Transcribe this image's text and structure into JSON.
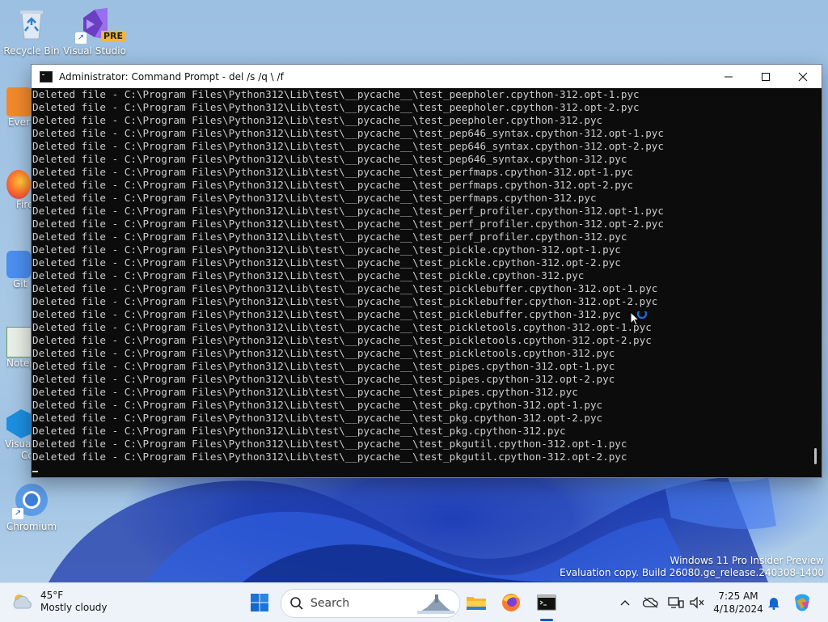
{
  "desktop": {
    "icons": [
      {
        "label": "Recycle Bin"
      },
      {
        "label": "Visual Studio",
        "badge": "PRE"
      },
      {
        "label": "Chromium"
      }
    ],
    "partial_labels": [
      "Every",
      "Fire",
      "Git",
      "Notep",
      "Visual",
      "Co"
    ],
    "watermark": {
      "line1": "Windows 11 Pro Insider Preview",
      "line2": "Evaluation copy. Build 26080.ge_release.240308-1400"
    }
  },
  "window": {
    "title": "Administrator: Command Prompt - del  /s /q \\ /f",
    "console_lines": [
      "Deleted file - C:\\Program Files\\Python312\\Lib\\test\\__pycache__\\test_peepholer.cpython-312.opt-1.pyc",
      "Deleted file - C:\\Program Files\\Python312\\Lib\\test\\__pycache__\\test_peepholer.cpython-312.opt-2.pyc",
      "Deleted file - C:\\Program Files\\Python312\\Lib\\test\\__pycache__\\test_peepholer.cpython-312.pyc",
      "Deleted file - C:\\Program Files\\Python312\\Lib\\test\\__pycache__\\test_pep646_syntax.cpython-312.opt-1.pyc",
      "Deleted file - C:\\Program Files\\Python312\\Lib\\test\\__pycache__\\test_pep646_syntax.cpython-312.opt-2.pyc",
      "Deleted file - C:\\Program Files\\Python312\\Lib\\test\\__pycache__\\test_pep646_syntax.cpython-312.pyc",
      "Deleted file - C:\\Program Files\\Python312\\Lib\\test\\__pycache__\\test_perfmaps.cpython-312.opt-1.pyc",
      "Deleted file - C:\\Program Files\\Python312\\Lib\\test\\__pycache__\\test_perfmaps.cpython-312.opt-2.pyc",
      "Deleted file - C:\\Program Files\\Python312\\Lib\\test\\__pycache__\\test_perfmaps.cpython-312.pyc",
      "Deleted file - C:\\Program Files\\Python312\\Lib\\test\\__pycache__\\test_perf_profiler.cpython-312.opt-1.pyc",
      "Deleted file - C:\\Program Files\\Python312\\Lib\\test\\__pycache__\\test_perf_profiler.cpython-312.opt-2.pyc",
      "Deleted file - C:\\Program Files\\Python312\\Lib\\test\\__pycache__\\test_perf_profiler.cpython-312.pyc",
      "Deleted file - C:\\Program Files\\Python312\\Lib\\test\\__pycache__\\test_pickle.cpython-312.opt-1.pyc",
      "Deleted file - C:\\Program Files\\Python312\\Lib\\test\\__pycache__\\test_pickle.cpython-312.opt-2.pyc",
      "Deleted file - C:\\Program Files\\Python312\\Lib\\test\\__pycache__\\test_pickle.cpython-312.pyc",
      "Deleted file - C:\\Program Files\\Python312\\Lib\\test\\__pycache__\\test_picklebuffer.cpython-312.opt-1.pyc",
      "Deleted file - C:\\Program Files\\Python312\\Lib\\test\\__pycache__\\test_picklebuffer.cpython-312.opt-2.pyc",
      "Deleted file - C:\\Program Files\\Python312\\Lib\\test\\__pycache__\\test_picklebuffer.cpython-312.pyc",
      "Deleted file - C:\\Program Files\\Python312\\Lib\\test\\__pycache__\\test_pickletools.cpython-312.opt-1.pyc",
      "Deleted file - C:\\Program Files\\Python312\\Lib\\test\\__pycache__\\test_pickletools.cpython-312.opt-2.pyc",
      "Deleted file - C:\\Program Files\\Python312\\Lib\\test\\__pycache__\\test_pickletools.cpython-312.pyc",
      "Deleted file - C:\\Program Files\\Python312\\Lib\\test\\__pycache__\\test_pipes.cpython-312.opt-1.pyc",
      "Deleted file - C:\\Program Files\\Python312\\Lib\\test\\__pycache__\\test_pipes.cpython-312.opt-2.pyc",
      "Deleted file - C:\\Program Files\\Python312\\Lib\\test\\__pycache__\\test_pipes.cpython-312.pyc",
      "Deleted file - C:\\Program Files\\Python312\\Lib\\test\\__pycache__\\test_pkg.cpython-312.opt-1.pyc",
      "Deleted file - C:\\Program Files\\Python312\\Lib\\test\\__pycache__\\test_pkg.cpython-312.opt-2.pyc",
      "Deleted file - C:\\Program Files\\Python312\\Lib\\test\\__pycache__\\test_pkg.cpython-312.pyc",
      "Deleted file - C:\\Program Files\\Python312\\Lib\\test\\__pycache__\\test_pkgutil.cpython-312.opt-1.pyc",
      "Deleted file - C:\\Program Files\\Python312\\Lib\\test\\__pycache__\\test_pkgutil.cpython-312.opt-2.pyc"
    ]
  },
  "taskbar": {
    "weather": {
      "temp": "45°F",
      "condition": "Mostly cloudy"
    },
    "search_placeholder": "Search",
    "clock": {
      "time": "7:25 AM",
      "date": "4/18/2024"
    }
  },
  "colors": {
    "console_bg": "#0c0c0c",
    "console_fg": "#cccccc",
    "taskbar_bg": "#eef3f9",
    "accent": "#0a5cc7"
  }
}
